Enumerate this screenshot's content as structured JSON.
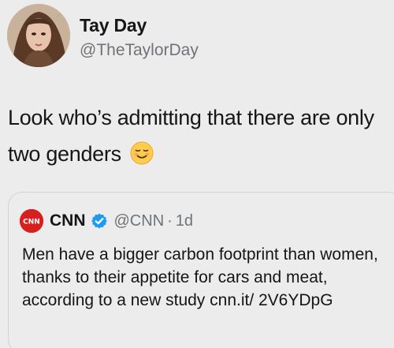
{
  "tweet": {
    "author": {
      "name": "Tay Day",
      "handle": "@TheTaylorDay",
      "avatar_icon": "profile-photo-avatar"
    },
    "text": "Look who’s admitting that there are only two genders",
    "emoji": "relieved-face-emoji",
    "quoted_tweet": {
      "author": {
        "name": "CNN",
        "logo_text": "CNN",
        "logo_icon": "cnn-logo",
        "verified_icon": "verified-badge-icon",
        "handle": "@CNN",
        "separator": "·",
        "time": "1d"
      },
      "text": "Men have a bigger carbon footprint than women, thanks to their appetite for cars and meat, according to a new study cnn.it/ 2V6YDpG"
    }
  },
  "colors": {
    "background": "#ececec",
    "text": "#161616",
    "secondary_text": "#6f7378",
    "border": "#cfd3d7",
    "cnn_red": "#d91e1e",
    "verified_blue": "#1d9bf0",
    "emoji_yellow": "#ffcc4d"
  }
}
